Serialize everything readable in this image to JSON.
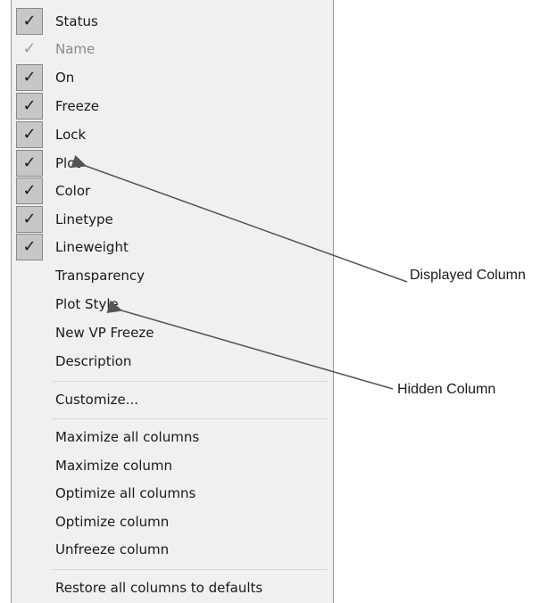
{
  "menu": {
    "columns": [
      {
        "label": "Status",
        "checked": true,
        "disabled": false
      },
      {
        "label": "Name",
        "checked": true,
        "disabled": true
      },
      {
        "label": "On",
        "checked": true,
        "disabled": false
      },
      {
        "label": "Freeze",
        "checked": true,
        "disabled": false
      },
      {
        "label": "Lock",
        "checked": true,
        "disabled": false
      },
      {
        "label": "Plot",
        "checked": true,
        "disabled": false
      },
      {
        "label": "Color",
        "checked": true,
        "disabled": false
      },
      {
        "label": "Linetype",
        "checked": true,
        "disabled": false
      },
      {
        "label": "Lineweight",
        "checked": true,
        "disabled": false
      },
      {
        "label": "Transparency",
        "checked": false,
        "disabled": false
      },
      {
        "label": "Plot Style",
        "checked": false,
        "disabled": false
      },
      {
        "label": "New VP Freeze",
        "checked": false,
        "disabled": false
      },
      {
        "label": "Description",
        "checked": false,
        "disabled": false
      }
    ],
    "customize_label": "Customize...",
    "column_actions": [
      "Maximize all columns",
      "Maximize column",
      "Optimize all columns",
      "Optimize column",
      "Unfreeze column"
    ],
    "restore_label": "Restore all columns to defaults"
  },
  "callouts": {
    "displayed": "Displayed Column",
    "hidden": "Hidden Column"
  },
  "check_glyph": "✓"
}
